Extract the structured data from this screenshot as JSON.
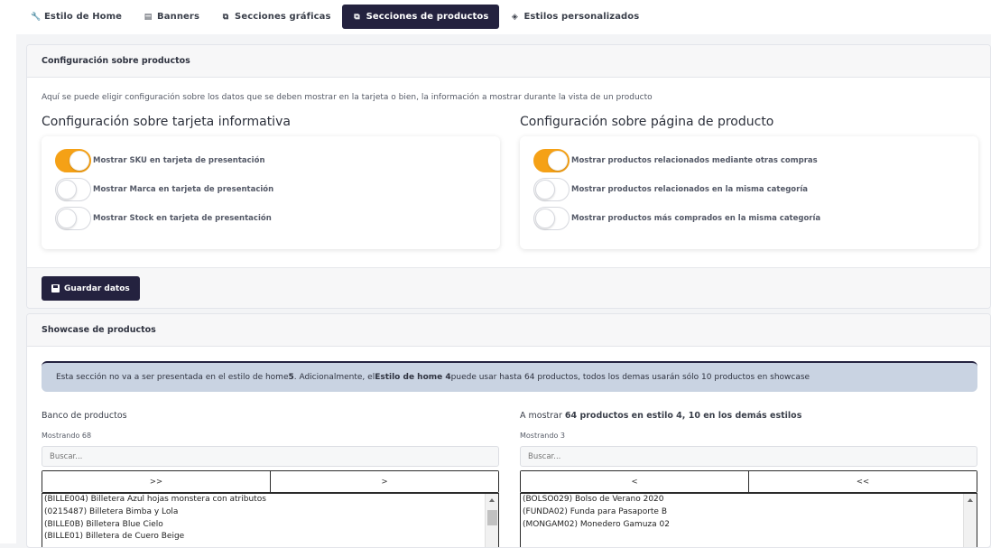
{
  "tabs": [
    {
      "icon": "wrench-icon",
      "glyph": "🔧",
      "label": "Estilo de Home"
    },
    {
      "icon": "images-icon",
      "glyph": "▤",
      "label": "Banners"
    },
    {
      "icon": "sitemap-icon",
      "glyph": "⧉",
      "label": "Secciones gráficas"
    },
    {
      "icon": "sitemap-icon",
      "glyph": "⧉",
      "label": "Secciones de productos"
    },
    {
      "icon": "css-icon",
      "glyph": "◈",
      "label": "Estilos personalizados"
    }
  ],
  "active_tab": "Secciones de productos",
  "config_card": {
    "header": "Configuración sobre productos",
    "intro": "Aquí se puede eligir configuración sobre los datos que se deben mostrar en la tarjeta o bien, la información a mostrar durante la vista de un producto",
    "left_title": "Configuración sobre tarjeta informativa",
    "right_title": "Configuración sobre página de producto",
    "left_toggles": [
      {
        "label": "Mostrar SKU en tarjeta de presentación",
        "on": true
      },
      {
        "label": "Mostrar Marca en tarjeta de presentación",
        "on": false
      },
      {
        "label": "Mostrar Stock en tarjeta de presentación",
        "on": false
      }
    ],
    "right_toggles": [
      {
        "label": "Mostrar productos relacionados mediante otras compras",
        "on": true
      },
      {
        "label": "Mostrar productos relacionados en la misma categoría",
        "on": false
      },
      {
        "label": "Mostrar productos más comprados en la misma categoría",
        "on": false
      }
    ],
    "save_label": "Guardar datos"
  },
  "showcase": {
    "header": "Showcase de productos",
    "alert": {
      "t1": "Esta sección no va a ser presentada en el estilo de home ",
      "b1": "5",
      "t2": ". Adicionalmente, el ",
      "b2": "Estilo de home 4",
      "t3": " puede usar hasta 64 productos, todos los demas usarán sólo 10 productos en showcase"
    },
    "bank": {
      "title": "Banco de productos",
      "count": "Mostrando 68",
      "placeholder": "Buscar...",
      "btn_all": ">>",
      "btn_one": ">",
      "items": [
        "(BILLE004) Billetera Azul hojas monstera con atributos",
        "(0215487) Billetera Bimba y Lola",
        "(BILLE0B) Billetera Blue Cielo",
        "(BILLE01) Billetera de Cuero Beige"
      ]
    },
    "shown": {
      "title_prefix": "A mostrar ",
      "title_bold": "64 productos en estilo 4, 10 en los demás estilos",
      "count": "Mostrando 3",
      "placeholder": "Buscar...",
      "btn_one": "<",
      "btn_all": "<<",
      "items": [
        "(BOLSO029) Bolso de Verano 2020",
        "(FUNDA02) Funda para Pasaporte B",
        "(MONGAM02) Monedero Gamuza 02"
      ]
    }
  },
  "colors": {
    "accent_dark": "#24223f",
    "toggle_on": "#f5a116",
    "alert_bg": "#c9d3e2"
  }
}
